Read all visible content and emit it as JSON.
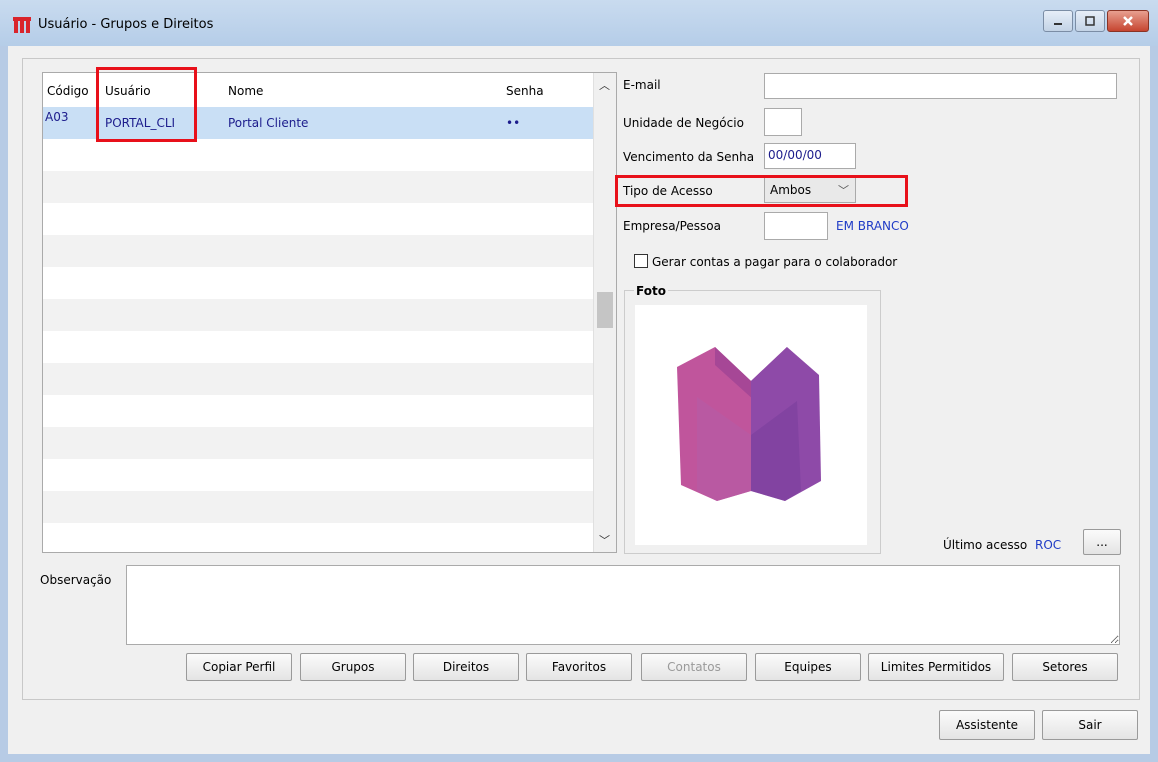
{
  "window": {
    "title": "Usuário - Grupos e Direitos"
  },
  "grid": {
    "columns": {
      "codigo": "Código",
      "usuario": "Usuário",
      "nome": "Nome",
      "senha": "Senha"
    },
    "rows": [
      {
        "codigo": "A03",
        "usuario": "PORTAL_CLI",
        "nome": "Portal Cliente",
        "senha": "••"
      }
    ]
  },
  "form": {
    "email_label": "E-mail",
    "email_value": "",
    "unidade_label": "Unidade de Negócio",
    "unidade_value": "",
    "vencimento_label": "Vencimento da Senha",
    "vencimento_value": "00/00/00",
    "tipo_label": "Tipo de Acesso",
    "tipo_value": "Ambos",
    "empresa_label": "Empresa/Pessoa",
    "empresa_value": "",
    "empresa_link": "EM BRANCO",
    "gerar_label": "Gerar contas a pagar para o colaborador",
    "foto_label": "Foto",
    "ultimo_label": "Último acesso",
    "ultimo_value": "ROC",
    "ultimo_btn": "...",
    "obs_label": "Observação"
  },
  "buttons": {
    "copiar": "Copiar Perfil",
    "grupos": "Grupos",
    "direitos": "Direitos",
    "favoritos": "Favoritos",
    "contatos": "Contatos",
    "equipes": "Equipes",
    "limites": "Limites Permitidos",
    "setores": "Setores",
    "assistente": "Assistente",
    "sair": "Sair"
  }
}
